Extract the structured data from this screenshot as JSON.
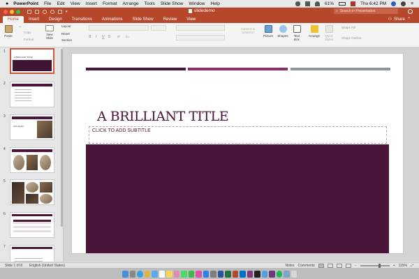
{
  "menubar": {
    "apple": "",
    "app_name": "PowerPoint",
    "items": [
      "File",
      "Edit",
      "View",
      "Insert",
      "Format",
      "Arrange",
      "Tools",
      "Slide Show",
      "Window",
      "Help"
    ],
    "battery": "61%",
    "clock": "Thu 6:42 PM"
  },
  "window": {
    "doc_title": "slidedemo",
    "search_placeholder": "Search in Presentation"
  },
  "tabs": [
    "Home",
    "Insert",
    "Design",
    "Transitions",
    "Animations",
    "Slide Show",
    "Review",
    "View"
  ],
  "share_label": "Share",
  "ribbon": {
    "paste": "Paste",
    "cut": "",
    "copy": "Copy",
    "format": "Format",
    "new_slide": "New Slide",
    "layout": "Layout",
    "reset": "Reset",
    "section": "Section",
    "convert_smartart": "Convert to SmartArt",
    "picture": "Picture",
    "shapes": "Shapes",
    "text_box": "Text Box",
    "arrange": "Arrange",
    "quick_styles": "Quick Styles",
    "shape_fill": "Shape Fill",
    "shape_outline": "Shape Outline"
  },
  "thumbnails": [
    {
      "num": "1",
      "label": "A BRILLIANT TITLE"
    },
    {
      "num": "2",
      "label": ""
    },
    {
      "num": "3",
      "label": "Schoolyard"
    },
    {
      "num": "4",
      "label": ""
    },
    {
      "num": "5",
      "label": ""
    },
    {
      "num": "6",
      "label": ""
    },
    {
      "num": "7",
      "label": ""
    }
  ],
  "slide": {
    "title": "A BRILLIANT TITLE",
    "subtitle": "CLICK TO ADD SUBTITLE"
  },
  "status": {
    "slide_info": "Slide 1 of 8",
    "language": "English (United States)",
    "notes": "Notes",
    "comments": "Comments",
    "zoom": "115%"
  },
  "colors": {
    "accent": "#b7472a",
    "plum": "#4b1439",
    "bar_dark": "#4a1538",
    "bar_mid": "#8b2d68",
    "bar_gray": "#8c979c"
  }
}
